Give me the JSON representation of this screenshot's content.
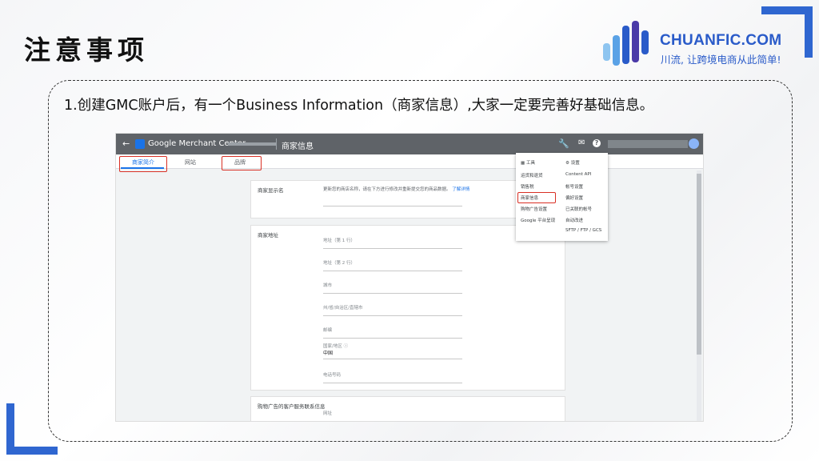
{
  "slide": {
    "title": "注意事项",
    "logo_name": "CHUANFIC.COM",
    "logo_slogan": "川流, 让跨境电商从此简单!",
    "description": "1.创建GMC账户后，有一个Business Information（商家信息）,大家一定要完善好基础信息。",
    "accent_color": "#2f66d0",
    "highlight_color": "#d93025"
  },
  "screenshot": {
    "app_name": "Google Merchant Center",
    "breadcrumb": "商家信息",
    "tabs": [
      "商家简介",
      "网站",
      "品牌"
    ],
    "cards": {
      "display_name_label": "商家显示名",
      "display_name_desc": "更新您的商店名称，请在下方进行修改并重新提交您的商品数据。",
      "learn_more": "了解详情",
      "address_label": "商家地址",
      "address_fields": [
        "地址（第 1 行）",
        "地址（第 2 行）",
        "城市",
        "州/省/自治区/直辖市",
        "邮编"
      ],
      "country_label": "国家/地区",
      "country_value": "中国",
      "phone_label": "电话号码",
      "support_label": "购物广告的客户服务联系信息",
      "support_website_label": "网址"
    },
    "menu": {
      "tools_header": "工具",
      "tools_items": [
        "运货和退货",
        "销售税",
        "商家信息",
        "购物广告设置",
        "Google 平台呈现"
      ],
      "settings_header": "设置",
      "settings_items": [
        "Content API",
        "帐号设置",
        "偏好设置",
        "已关联的帐号",
        "自动改进",
        "SFTP / FTP / GCS"
      ]
    }
  }
}
